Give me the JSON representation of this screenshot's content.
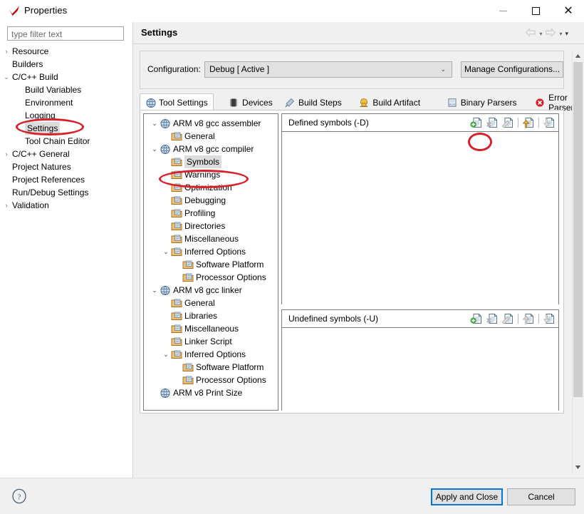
{
  "window": {
    "title": "Properties",
    "icon": "checkmark-icon",
    "minimize_label": "—",
    "maximize_label": "□",
    "close_label": "✕"
  },
  "sidebar": {
    "filter_placeholder": "type filter text",
    "filter_value": "",
    "items": [
      {
        "label": "Resource",
        "indent": 0,
        "twisty": "›",
        "selected": false
      },
      {
        "label": "Builders",
        "indent": 0,
        "twisty": "",
        "selected": false
      },
      {
        "label": "C/C++ Build",
        "indent": 0,
        "twisty": "⌄",
        "selected": false
      },
      {
        "label": "Build Variables",
        "indent": 1,
        "twisty": "",
        "selected": false
      },
      {
        "label": "Environment",
        "indent": 1,
        "twisty": "",
        "selected": false
      },
      {
        "label": "Logging",
        "indent": 1,
        "twisty": "",
        "selected": false
      },
      {
        "label": "Settings",
        "indent": 1,
        "twisty": "",
        "selected": true
      },
      {
        "label": "Tool Chain Editor",
        "indent": 1,
        "twisty": "",
        "selected": false
      },
      {
        "label": "C/C++ General",
        "indent": 0,
        "twisty": "›",
        "selected": false
      },
      {
        "label": "Project Natures",
        "indent": 0,
        "twisty": "",
        "selected": false
      },
      {
        "label": "Project References",
        "indent": 0,
        "twisty": "",
        "selected": false
      },
      {
        "label": "Run/Debug Settings",
        "indent": 0,
        "twisty": "",
        "selected": false
      },
      {
        "label": "Validation",
        "indent": 0,
        "twisty": "›",
        "selected": false
      }
    ]
  },
  "page": {
    "title": "Settings",
    "nav": {
      "back_icon": "back-arrow-icon",
      "back_caret": "▾",
      "forward_icon": "forward-arrow-icon",
      "forward_caret": "▾",
      "menu_caret": "▾"
    }
  },
  "configuration": {
    "label": "Configuration:",
    "value": "Debug  [ Active ]",
    "caret": "⌄",
    "manage_button": "Manage Configurations..."
  },
  "tabs": [
    {
      "label": "Tool Settings",
      "icon": "tool-settings-icon",
      "active": true
    },
    {
      "label": "Devices",
      "icon": "devices-icon",
      "active": false
    },
    {
      "label": "Build Steps",
      "icon": "build-steps-icon",
      "active": false
    },
    {
      "label": "Build Artifact",
      "icon": "build-artifact-icon",
      "active": false
    },
    {
      "label": "Binary Parsers",
      "icon": "binary-parsers-icon",
      "active": false
    },
    {
      "label": "Error Parsers",
      "icon": "error-parsers-icon",
      "active": false
    }
  ],
  "tool_tree": [
    {
      "label": "ARM v8 gcc assembler",
      "indent": 0,
      "twisty": "⌄",
      "icon": "tool-icon",
      "selected": false
    },
    {
      "label": "General",
      "indent": 1,
      "twisty": "",
      "icon": "option-icon",
      "selected": false
    },
    {
      "label": "ARM v8 gcc compiler",
      "indent": 0,
      "twisty": "⌄",
      "icon": "tool-icon",
      "selected": false
    },
    {
      "label": "Symbols",
      "indent": 1,
      "twisty": "",
      "icon": "option-icon",
      "selected": true
    },
    {
      "label": "Warnings",
      "indent": 1,
      "twisty": "",
      "icon": "option-icon",
      "selected": false
    },
    {
      "label": "Optimization",
      "indent": 1,
      "twisty": "",
      "icon": "option-icon",
      "selected": false
    },
    {
      "label": "Debugging",
      "indent": 1,
      "twisty": "",
      "icon": "option-icon",
      "selected": false
    },
    {
      "label": "Profiling",
      "indent": 1,
      "twisty": "",
      "icon": "option-icon",
      "selected": false
    },
    {
      "label": "Directories",
      "indent": 1,
      "twisty": "",
      "icon": "option-icon",
      "selected": false
    },
    {
      "label": "Miscellaneous",
      "indent": 1,
      "twisty": "",
      "icon": "option-icon",
      "selected": false
    },
    {
      "label": "Inferred Options",
      "indent": 1,
      "twisty": "⌄",
      "icon": "option-icon",
      "selected": false
    },
    {
      "label": "Software Platform",
      "indent": 2,
      "twisty": "",
      "icon": "option-icon",
      "selected": false
    },
    {
      "label": "Processor Options",
      "indent": 2,
      "twisty": "",
      "icon": "option-icon",
      "selected": false
    },
    {
      "label": "ARM v8 gcc linker",
      "indent": 0,
      "twisty": "⌄",
      "icon": "tool-icon",
      "selected": false
    },
    {
      "label": "General",
      "indent": 1,
      "twisty": "",
      "icon": "option-icon",
      "selected": false
    },
    {
      "label": "Libraries",
      "indent": 1,
      "twisty": "",
      "icon": "option-icon",
      "selected": false
    },
    {
      "label": "Miscellaneous",
      "indent": 1,
      "twisty": "",
      "icon": "option-icon",
      "selected": false
    },
    {
      "label": "Linker Script",
      "indent": 1,
      "twisty": "",
      "icon": "option-icon",
      "selected": false
    },
    {
      "label": "Inferred Options",
      "indent": 1,
      "twisty": "⌄",
      "icon": "option-icon",
      "selected": false
    },
    {
      "label": "Software Platform",
      "indent": 2,
      "twisty": "",
      "icon": "option-icon",
      "selected": false
    },
    {
      "label": "Processor Options",
      "indent": 2,
      "twisty": "",
      "icon": "option-icon",
      "selected": false
    },
    {
      "label": "ARM v8 Print Size",
      "indent": 0,
      "twisty": "",
      "icon": "tool-icon",
      "selected": false
    }
  ],
  "defined_symbols": {
    "header": "Defined symbols (-D)",
    "entries": [],
    "tools": [
      {
        "name": "add-icon",
        "enabled": true
      },
      {
        "name": "delete-icon",
        "enabled": false
      },
      {
        "name": "edit-icon",
        "enabled": false
      },
      {
        "name": "move-up-icon",
        "enabled": true
      },
      {
        "name": "move-down-icon",
        "enabled": false
      }
    ]
  },
  "undefined_symbols": {
    "header": "Undefined symbols (-U)",
    "entries": [],
    "tools": [
      {
        "name": "add-icon",
        "enabled": true
      },
      {
        "name": "delete-icon",
        "enabled": false
      },
      {
        "name": "edit-icon",
        "enabled": false
      },
      {
        "name": "move-up-icon",
        "enabled": false
      },
      {
        "name": "move-down-icon",
        "enabled": false
      }
    ]
  },
  "scrollbar": {
    "up_arrow": "▲",
    "down_arrow": "▼"
  },
  "footer": {
    "help_icon": "help-icon",
    "apply_button": "Apply and Close",
    "cancel_button": "Cancel"
  },
  "annotations": [
    {
      "name": "annotation-settings-ellipse",
      "target": "sidebar Settings"
    },
    {
      "name": "annotation-symbols-ellipse",
      "target": "tool tree Symbols"
    },
    {
      "name": "annotation-add-symbol-ellipse",
      "target": "defined symbols add button"
    }
  ],
  "colors": {
    "annotation_red": "#d8202a",
    "accent_blue": "#0078d7",
    "selection_grey": "#dcdcdc",
    "edge_pink": "#e0499b"
  }
}
